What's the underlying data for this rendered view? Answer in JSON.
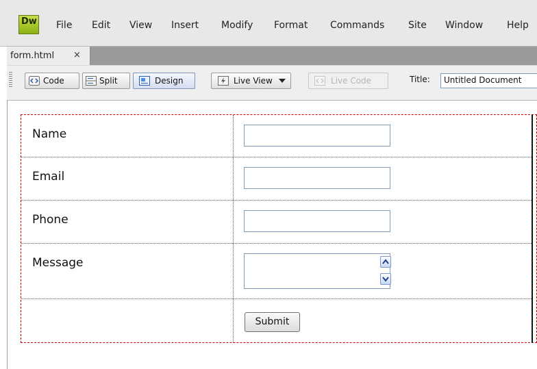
{
  "app": {
    "logo_text": "Dw"
  },
  "menu": [
    "File",
    "Edit",
    "View",
    "Insert",
    "Modify",
    "Format",
    "Commands",
    "Site",
    "Window",
    "Help"
  ],
  "document_tab": {
    "filename": "form.html",
    "close_glyph": "×"
  },
  "toolbar": {
    "code_label": "Code",
    "split_label": "Split",
    "design_label": "Design",
    "live_view_label": "Live View",
    "live_code_label": "Live Code",
    "title_label": "Title:",
    "title_value": "Untitled Document"
  },
  "form": {
    "rows": [
      {
        "label": "Name"
      },
      {
        "label": "Email"
      },
      {
        "label": "Phone"
      },
      {
        "label": "Message"
      }
    ],
    "submit_label": "Submit"
  },
  "colors": {
    "form_border": "#cc0000",
    "input_border": "#7f9db9",
    "logo": "#8bb012"
  }
}
